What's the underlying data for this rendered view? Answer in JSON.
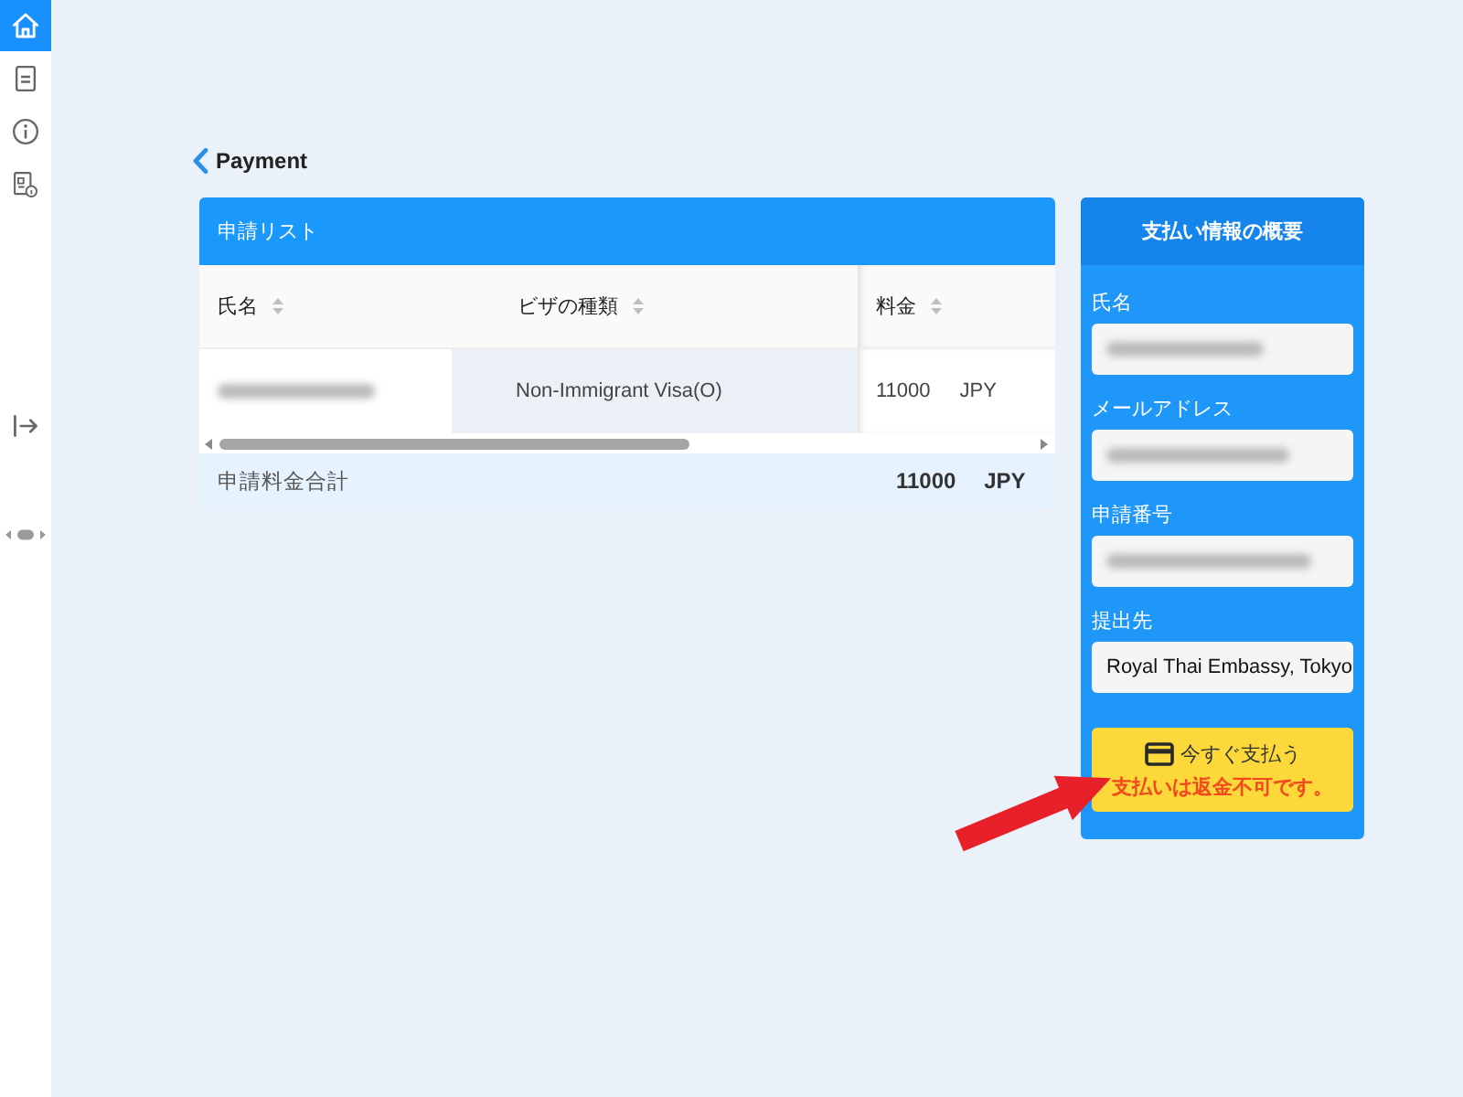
{
  "sidebar": {
    "items": [
      {
        "kind": "home",
        "selected": true
      },
      {
        "kind": "document",
        "selected": false
      },
      {
        "kind": "info",
        "selected": false
      },
      {
        "kind": "report",
        "selected": false
      }
    ],
    "bottom_items": [
      {
        "kind": "logout",
        "selected": false
      }
    ]
  },
  "page": {
    "back_title": "Payment"
  },
  "application_list": {
    "title": "申請リスト",
    "columns": [
      {
        "label": "氏名",
        "sortable": true,
        "highlighted": false
      },
      {
        "label": "ビザの種類",
        "sortable": true,
        "highlighted": true
      },
      {
        "label": "料金",
        "sortable": true,
        "highlighted": false
      }
    ],
    "rows": [
      {
        "name_redacted": true,
        "visa_type": "Non-Immigrant Visa(O)",
        "amount": "11000",
        "currency": "JPY"
      }
    ],
    "total": {
      "label": "申請料金合計",
      "amount": "11000",
      "currency": "JPY"
    }
  },
  "summary": {
    "title": "支払い情報の概要",
    "fields": [
      {
        "label": "氏名",
        "redacted": true
      },
      {
        "label": "メールアドレス",
        "redacted": true
      },
      {
        "label": "申請番号",
        "redacted": true
      },
      {
        "label": "提出先",
        "value": "Royal Thai Embassy, Tokyo",
        "redacted": false
      }
    ],
    "pay_button": {
      "label": "今すぐ支払う",
      "note": "支払いは返金不可です。"
    }
  },
  "annotations": [
    {
      "kind": "arrow"
    }
  ]
}
